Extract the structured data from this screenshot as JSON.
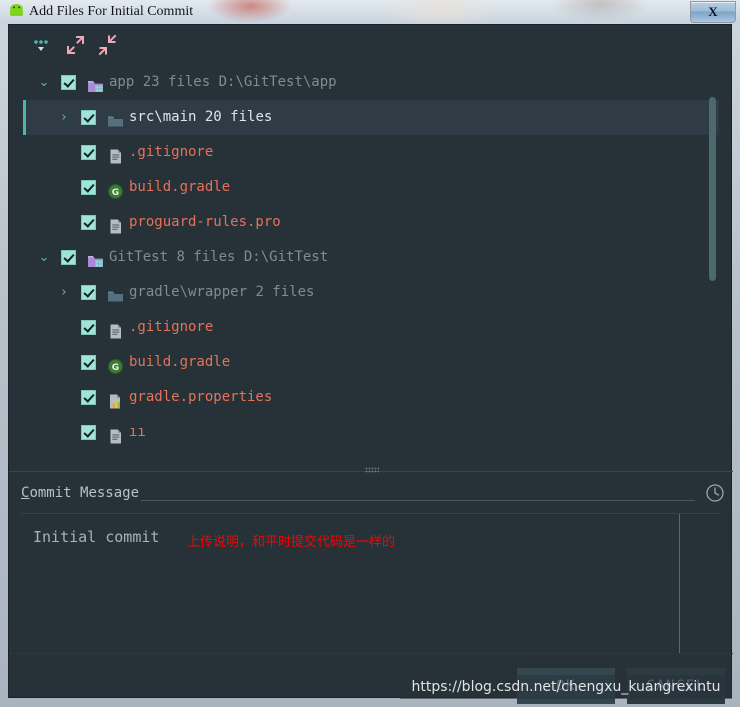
{
  "window": {
    "title": "Add Files For Initial Commit",
    "app_icon": "android-icon",
    "close_label": "X"
  },
  "toolbar": {
    "buttons": [
      {
        "name": "show-options-menu",
        "icon": "ellipsis-dropdown-icon",
        "label": "..."
      },
      {
        "name": "expand-all",
        "icon": "expand-all-icon",
        "label": ""
      },
      {
        "name": "collapse-all",
        "icon": "collapse-all-icon",
        "label": ""
      }
    ]
  },
  "tree": {
    "rows": [
      {
        "twisty": "⌄",
        "checked": true,
        "icon": "module-folder-icon",
        "name": "app",
        "count": "23 files",
        "path": "D:\\GitTest\\app",
        "selected": false,
        "indent": 0
      },
      {
        "twisty": "›",
        "checked": true,
        "icon": "folder-icon",
        "name": "src\\main",
        "count": "20 files",
        "path": "",
        "selected": true,
        "indent": 1
      },
      {
        "twisty": "",
        "checked": true,
        "icon": "text-file-icon",
        "name": ".gitignore",
        "count": "",
        "path": "",
        "selected": false,
        "indent": 1
      },
      {
        "twisty": "",
        "checked": true,
        "icon": "gradle-file-icon",
        "name": "build.gradle",
        "count": "",
        "path": "",
        "selected": false,
        "indent": 1
      },
      {
        "twisty": "",
        "checked": true,
        "icon": "text-file-icon",
        "name": "proguard-rules.pro",
        "count": "",
        "path": "",
        "selected": false,
        "indent": 1
      },
      {
        "twisty": "⌄",
        "checked": true,
        "icon": "module-folder-icon",
        "name": "GitTest",
        "count": "8 files",
        "path": "D:\\GitTest",
        "selected": false,
        "indent": 0
      },
      {
        "twisty": "›",
        "checked": true,
        "icon": "folder-icon",
        "name": "gradle\\wrapper",
        "count": "2 files",
        "path": "",
        "selected": false,
        "indent": 1
      },
      {
        "twisty": "",
        "checked": true,
        "icon": "text-file-icon",
        "name": ".gitignore",
        "count": "",
        "path": "",
        "selected": false,
        "indent": 1
      },
      {
        "twisty": "",
        "checked": true,
        "icon": "gradle-file-icon",
        "name": "build.gradle",
        "count": "",
        "path": "",
        "selected": false,
        "indent": 1
      },
      {
        "twisty": "",
        "checked": true,
        "icon": "properties-file-icon",
        "name": "gradle.properties",
        "count": "",
        "path": "",
        "selected": false,
        "indent": 1
      },
      {
        "twisty": "",
        "checked": true,
        "icon": "text-file-icon",
        "name": "ıı",
        "count": "",
        "path": "",
        "selected": false,
        "indent": 1
      }
    ]
  },
  "commit": {
    "label_mnemonic": "C",
    "label_rest": "ommit Message",
    "history_icon": "clock-history-icon",
    "text": "Initial commit",
    "annotation": "上传说明，和平时提交代码是一样的"
  },
  "buttons": {
    "ok": "OK",
    "cancel": "CANCEL"
  },
  "watermark": {
    "url": "https://blog.csdn.net/chengxu_kuangrexintu"
  },
  "colors": {
    "background": "#263238",
    "selection": "#2f3c45",
    "accent_teal": "#4db6ac",
    "file_text": "#e8715a",
    "muted_text": "#7f8c92",
    "annotation_red": "#ff0000"
  }
}
